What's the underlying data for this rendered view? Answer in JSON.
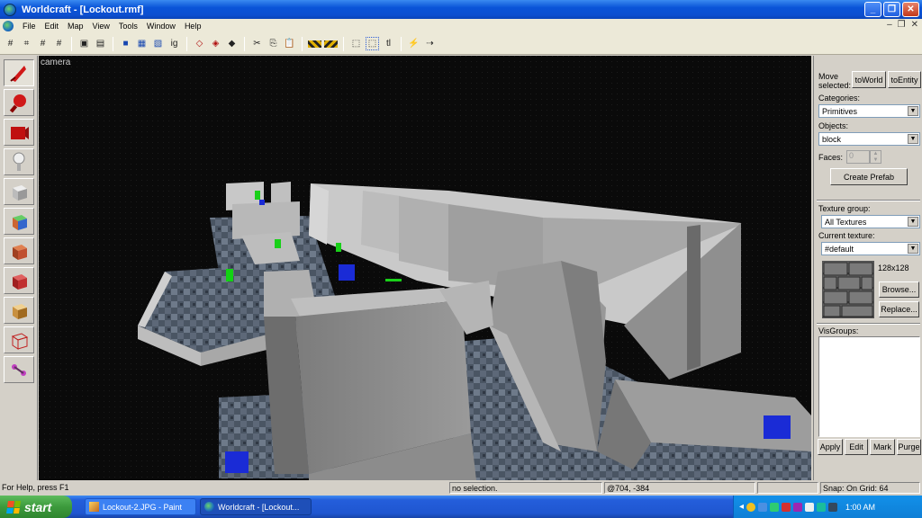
{
  "window": {
    "title": "Worldcraft - [Lockout.rmf]"
  },
  "menu": [
    "File",
    "Edit",
    "Map",
    "View",
    "Tools",
    "Window",
    "Help"
  ],
  "toolbar": {
    "ig_label": "ig",
    "tl_label": "tl"
  },
  "viewport": {
    "label": "camera"
  },
  "panel": {
    "move_selected_label": "Move selected:",
    "to_world": "toWorld",
    "to_entity": "toEntity",
    "categories_label": "Categories:",
    "categories_value": "Primitives",
    "objects_label": "Objects:",
    "objects_value": "block",
    "faces_label": "Faces:",
    "faces_value": "0",
    "create_prefab": "Create Prefab",
    "texture_group_label": "Texture group:",
    "texture_group_value": "All Textures",
    "current_texture_label": "Current texture:",
    "current_texture_value": "#default",
    "texture_size": "128x128",
    "browse": "Browse...",
    "replace": "Replace...",
    "visgroups_label": "VisGroups:",
    "apply": "Apply",
    "edit": "Edit",
    "mark": "Mark",
    "purge": "Purge"
  },
  "status": {
    "help": "For Help, press F1",
    "selection": "no selection.",
    "coords": "@704, -384",
    "snap": "Snap: On Grid: 64"
  },
  "taskbar": {
    "start": "start",
    "tasks": [
      "Lockout-2.JPG - Paint",
      "Worldcraft - [Lockout..."
    ],
    "clock": "1:00 AM"
  }
}
